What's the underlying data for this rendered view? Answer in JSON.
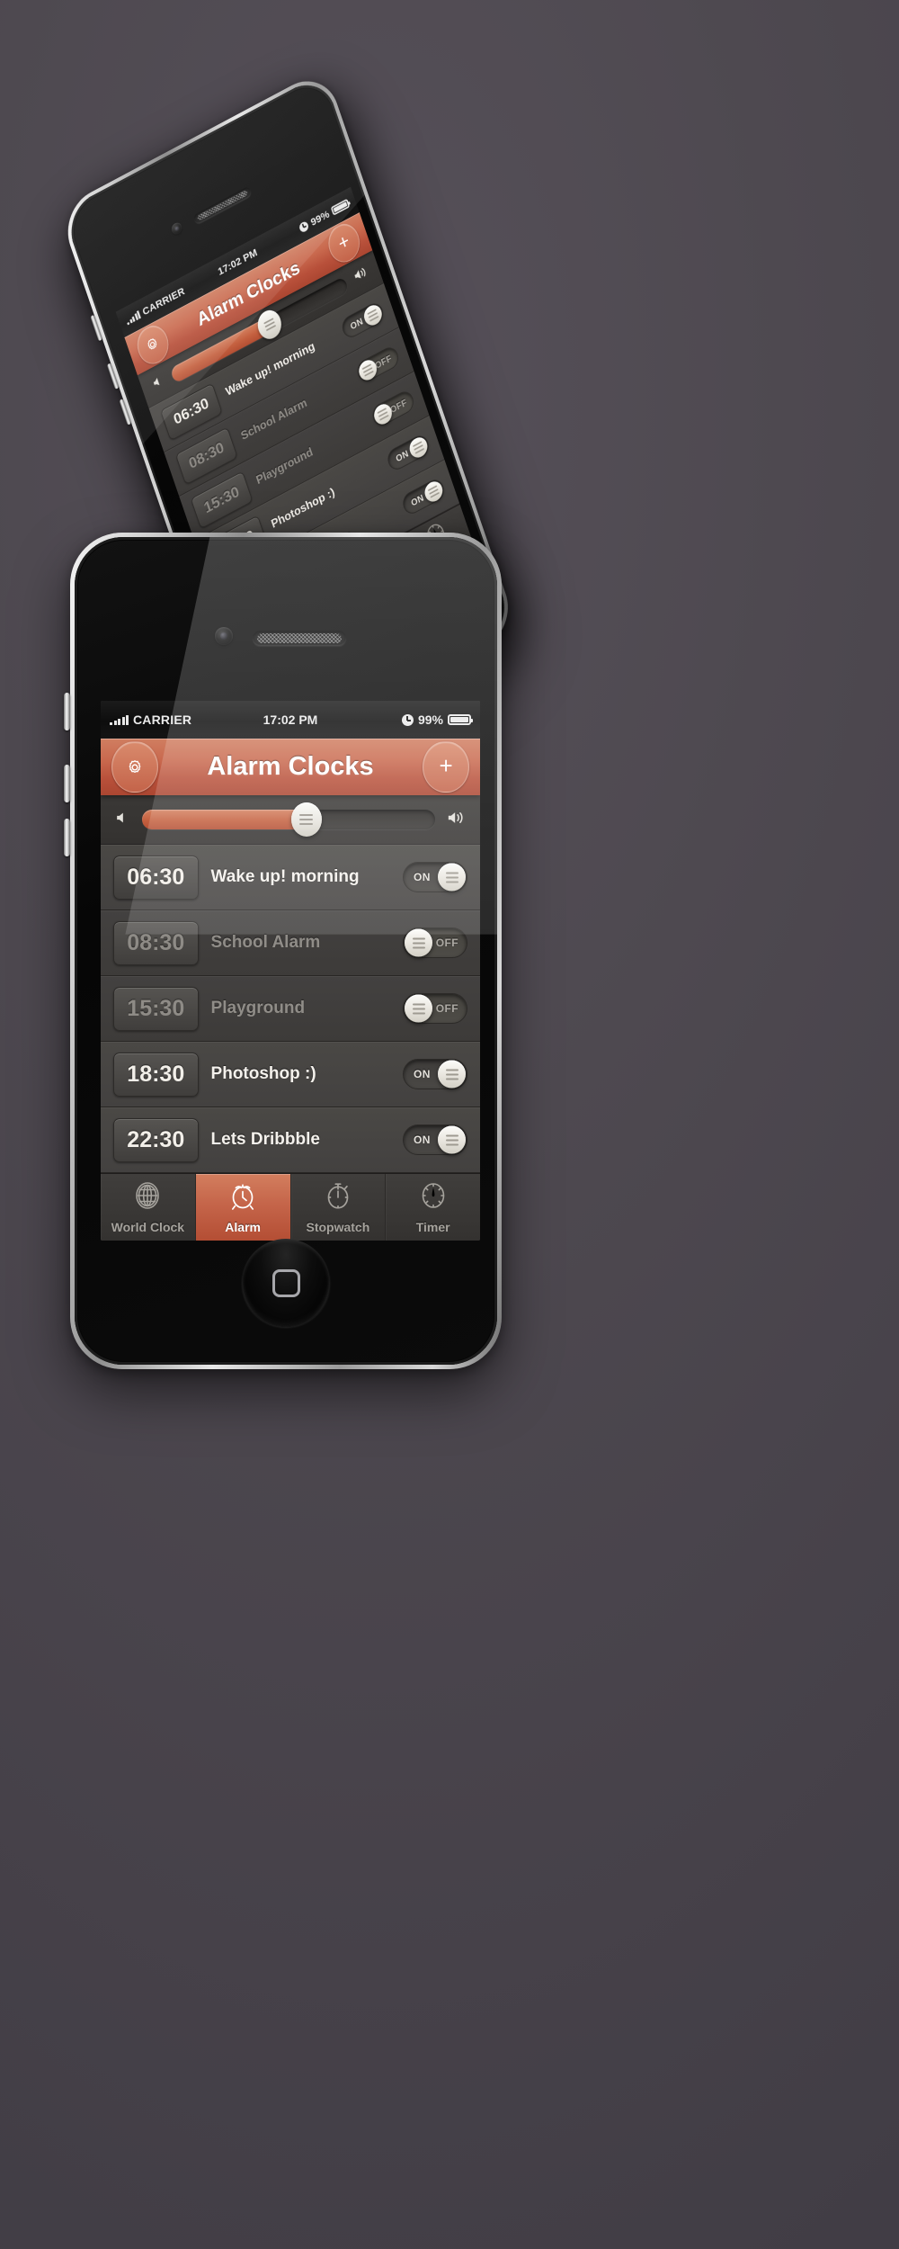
{
  "theme": {
    "background": "#4e4950",
    "accent": "#c5654a",
    "accent_light": "#d37e5e",
    "screen_bg": "#3b3937",
    "text_on": "#f4f1ec",
    "text_off": "#908d88"
  },
  "status_bar": {
    "signal_icon": "signal-bars-icon",
    "carrier": "CARRIER",
    "time": "17:02 PM",
    "alarm_clock_icon": "clock-icon",
    "battery_percent": "99%",
    "battery_icon": "battery-icon"
  },
  "navbar": {
    "settings_icon": "gear-icon",
    "title": "Alarm Clocks",
    "add_label": "+"
  },
  "volume": {
    "mute_icon": "speaker-low-icon",
    "loud_icon": "speaker-high-icon",
    "value_percent": 56,
    "knob_icon": "slider-knob-icon"
  },
  "alarms": [
    {
      "time": "06:30",
      "label": "Wake up! morning",
      "state": "on",
      "toggle_label": "ON"
    },
    {
      "time": "08:30",
      "label": "School Alarm",
      "state": "off",
      "toggle_label": "OFF"
    },
    {
      "time": "15:30",
      "label": "Playground",
      "state": "off",
      "toggle_label": "OFF"
    },
    {
      "time": "18:30",
      "label": "Photoshop :)",
      "state": "on",
      "toggle_label": "ON"
    },
    {
      "time": "22:30",
      "label": "Lets Dribbble",
      "state": "on",
      "toggle_label": "ON"
    }
  ],
  "tabs": [
    {
      "label": "World Clock",
      "icon": "globe-icon",
      "active": false
    },
    {
      "label": "Alarm",
      "icon": "alarm-clock-icon",
      "active": true
    },
    {
      "label": "Stopwatch",
      "icon": "stopwatch-icon",
      "active": false
    },
    {
      "label": "Timer",
      "icon": "timer-gauge-icon",
      "active": false
    }
  ],
  "device": {
    "home_button": "home-button",
    "front_camera": "front-camera",
    "earpiece": "earpiece-speaker",
    "silent_switch": "silent-switch",
    "volume_up": "volume-up-button",
    "volume_down": "volume-down-button"
  }
}
